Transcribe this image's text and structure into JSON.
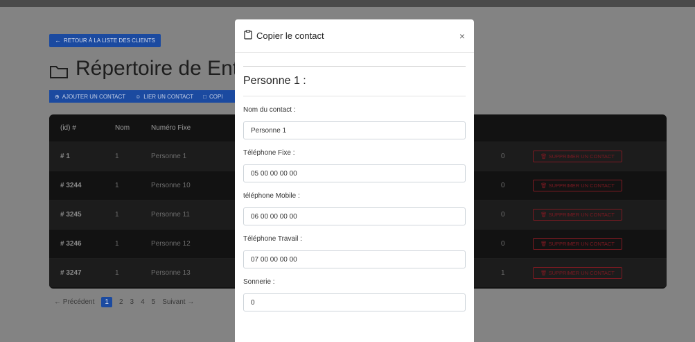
{
  "back_button": {
    "label": "Retour à la liste des clients"
  },
  "page_title": "Répertoire de Entre",
  "toolbar": {
    "items": [
      {
        "label": "Ajouter un contact"
      },
      {
        "label": "Lier un contact"
      },
      {
        "label": "Copi"
      }
    ]
  },
  "table": {
    "headers": {
      "id": "(id) #",
      "nom": "Nom",
      "numero_fixe": "Numéro Fixe"
    },
    "delete_label": "Supprimer un contact",
    "rows": [
      {
        "id": "# 1",
        "nom": "1",
        "numero": "Personne 1",
        "sonnerie": "0"
      },
      {
        "id": "# 3244",
        "nom": "1",
        "numero": "Personne 10",
        "sonnerie": "0"
      },
      {
        "id": "# 3245",
        "nom": "1",
        "numero": "Personne 11",
        "sonnerie": "0"
      },
      {
        "id": "# 3246",
        "nom": "1",
        "numero": "Personne 12",
        "sonnerie": "0"
      },
      {
        "id": "# 3247",
        "nom": "1",
        "numero": "Personne 13",
        "sonnerie": "1"
      }
    ]
  },
  "pagination": {
    "prev": "Précédent",
    "pages": [
      "1",
      "2",
      "3",
      "4",
      "5"
    ],
    "next": "Suivant",
    "active": "1"
  },
  "modal": {
    "title": "Copier le contact",
    "close": "×",
    "section_title": "Personne 1 :",
    "fields": {
      "nom": {
        "label": "Nom du contact :",
        "value": "Personne 1"
      },
      "fixe": {
        "label": "Téléphone Fixe :",
        "value": "05 00 00 00 00"
      },
      "mobile": {
        "label": "téléphone Mobile :",
        "value": "06 00 00 00 00"
      },
      "travail": {
        "label": "Téléphone Travail :",
        "value": "07 00 00 00 00"
      },
      "sonnerie": {
        "label": "Sonnerie :",
        "value": "0"
      }
    }
  },
  "colors": {
    "primary": "#1b4aa0",
    "danger": "#7d1a22",
    "table_bg": "#121212",
    "overlay": "#838383"
  }
}
